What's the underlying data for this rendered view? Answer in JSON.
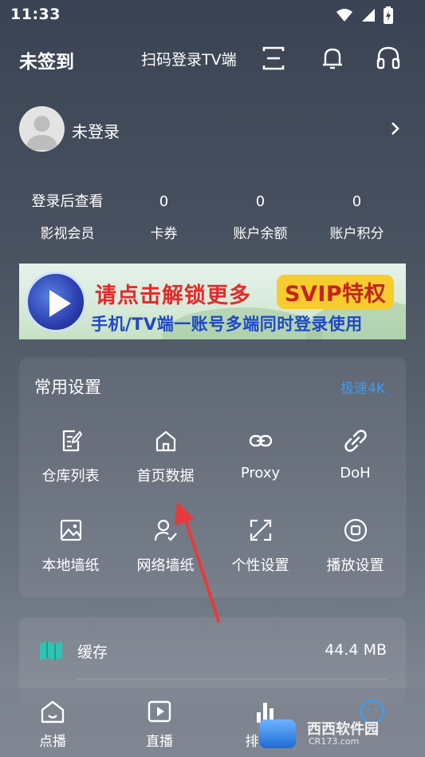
{
  "status_bar": {
    "time": "11:33"
  },
  "header": {
    "checkin_label": "未签到",
    "scan_login_label": "扫码登录TV端",
    "icons": [
      "scan-icon",
      "bell-icon",
      "headset-icon"
    ]
  },
  "profile": {
    "name": "未登录",
    "icon": "chevron-right-icon"
  },
  "stats": [
    {
      "value": "登录后查看",
      "label": "影视会员"
    },
    {
      "value": "0",
      "label": "卡券"
    },
    {
      "value": "0",
      "label": "账户余额"
    },
    {
      "value": "0",
      "label": "账户积分"
    }
  ],
  "banner": {
    "line1": "请点击解锁更多",
    "badge": "SVIP特权",
    "line2": "手机/TV端一账号多端同时登录使用"
  },
  "settings": {
    "title": "常用设置",
    "speed_label": "极速4K",
    "speed_color": "#3d9cf0",
    "items": [
      {
        "label": "仓库列表",
        "icon": "document-edit-icon"
      },
      {
        "label": "首页数据",
        "icon": "home-icon"
      },
      {
        "label": "Proxy",
        "icon": "link-icon"
      },
      {
        "label": "DoH",
        "icon": "chain-icon"
      },
      {
        "label": "本地墙纸",
        "icon": "image-icon"
      },
      {
        "label": "网络墙纸",
        "icon": "user-check-icon"
      },
      {
        "label": "个性设置",
        "icon": "expand-icon"
      },
      {
        "label": "播放设置",
        "icon": "record-icon"
      }
    ]
  },
  "cache": {
    "label": "缓存",
    "value": "44.4 MB",
    "icon": "map-icon",
    "icon_color": "#2fc4b2"
  },
  "bottom_nav": [
    {
      "label": "点播",
      "icon": "home-icon"
    },
    {
      "label": "直播",
      "icon": "play-square-icon"
    },
    {
      "label": "排行榜",
      "icon": "bar-chart-icon"
    },
    {
      "label": "",
      "icon": "smile-icon"
    }
  ],
  "watermark": {
    "text": "西西软件园",
    "sub": "CR173.com"
  },
  "accent_colors": {
    "arrow": "#e83a3a",
    "banner_red": "#e52a2a",
    "banner_blue": "#1f49c4",
    "badge_yellow": "#f6cc2e"
  }
}
